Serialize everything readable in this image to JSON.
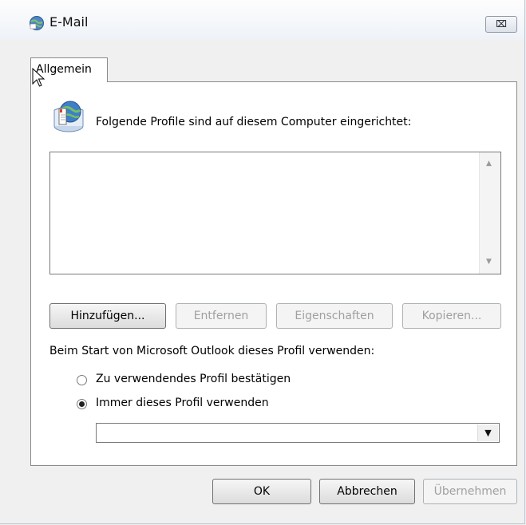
{
  "window": {
    "title": "E-Mail",
    "close_symbol": "⌧"
  },
  "tabs": [
    {
      "label": "Allgemein",
      "active": true
    }
  ],
  "profiles_section": {
    "heading": "Folgende Profile sind auf diesem Computer eingerichtet:",
    "profiles": [],
    "icon": "mail-profile-icon"
  },
  "buttons": {
    "add": "Hinzufügen...",
    "remove": "Entfernen",
    "properties": "Eigenschaften",
    "copy": "Kopieren..."
  },
  "startup": {
    "label": "Beim Start von Microsoft Outlook dieses Profil verwenden:",
    "option_confirm": "Zu verwendendes Profil bestätigen",
    "option_always": "Immer dieses Profil verwenden",
    "selected_option": "option_always",
    "selected_profile": ""
  },
  "footer": {
    "ok": "OK",
    "cancel": "Abbrechen",
    "apply": "Übernehmen"
  },
  "colors": {
    "window_border": "#b9c5d6",
    "disabled_text": "#a0a0a0"
  }
}
